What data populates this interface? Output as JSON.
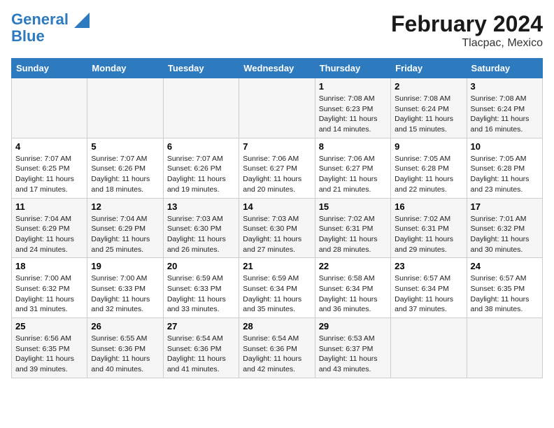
{
  "logo": {
    "line1": "General",
    "line2": "Blue"
  },
  "title": "February 2024",
  "subtitle": "Tlacpac, Mexico",
  "weekdays": [
    "Sunday",
    "Monday",
    "Tuesday",
    "Wednesday",
    "Thursday",
    "Friday",
    "Saturday"
  ],
  "weeks": [
    [
      {
        "day": "",
        "info": ""
      },
      {
        "day": "",
        "info": ""
      },
      {
        "day": "",
        "info": ""
      },
      {
        "day": "",
        "info": ""
      },
      {
        "day": "1",
        "info": "Sunrise: 7:08 AM\nSunset: 6:23 PM\nDaylight: 11 hours\nand 14 minutes."
      },
      {
        "day": "2",
        "info": "Sunrise: 7:08 AM\nSunset: 6:24 PM\nDaylight: 11 hours\nand 15 minutes."
      },
      {
        "day": "3",
        "info": "Sunrise: 7:08 AM\nSunset: 6:24 PM\nDaylight: 11 hours\nand 16 minutes."
      }
    ],
    [
      {
        "day": "4",
        "info": "Sunrise: 7:07 AM\nSunset: 6:25 PM\nDaylight: 11 hours\nand 17 minutes."
      },
      {
        "day": "5",
        "info": "Sunrise: 7:07 AM\nSunset: 6:26 PM\nDaylight: 11 hours\nand 18 minutes."
      },
      {
        "day": "6",
        "info": "Sunrise: 7:07 AM\nSunset: 6:26 PM\nDaylight: 11 hours\nand 19 minutes."
      },
      {
        "day": "7",
        "info": "Sunrise: 7:06 AM\nSunset: 6:27 PM\nDaylight: 11 hours\nand 20 minutes."
      },
      {
        "day": "8",
        "info": "Sunrise: 7:06 AM\nSunset: 6:27 PM\nDaylight: 11 hours\nand 21 minutes."
      },
      {
        "day": "9",
        "info": "Sunrise: 7:05 AM\nSunset: 6:28 PM\nDaylight: 11 hours\nand 22 minutes."
      },
      {
        "day": "10",
        "info": "Sunrise: 7:05 AM\nSunset: 6:28 PM\nDaylight: 11 hours\nand 23 minutes."
      }
    ],
    [
      {
        "day": "11",
        "info": "Sunrise: 7:04 AM\nSunset: 6:29 PM\nDaylight: 11 hours\nand 24 minutes."
      },
      {
        "day": "12",
        "info": "Sunrise: 7:04 AM\nSunset: 6:29 PM\nDaylight: 11 hours\nand 25 minutes."
      },
      {
        "day": "13",
        "info": "Sunrise: 7:03 AM\nSunset: 6:30 PM\nDaylight: 11 hours\nand 26 minutes."
      },
      {
        "day": "14",
        "info": "Sunrise: 7:03 AM\nSunset: 6:30 PM\nDaylight: 11 hours\nand 27 minutes."
      },
      {
        "day": "15",
        "info": "Sunrise: 7:02 AM\nSunset: 6:31 PM\nDaylight: 11 hours\nand 28 minutes."
      },
      {
        "day": "16",
        "info": "Sunrise: 7:02 AM\nSunset: 6:31 PM\nDaylight: 11 hours\nand 29 minutes."
      },
      {
        "day": "17",
        "info": "Sunrise: 7:01 AM\nSunset: 6:32 PM\nDaylight: 11 hours\nand 30 minutes."
      }
    ],
    [
      {
        "day": "18",
        "info": "Sunrise: 7:00 AM\nSunset: 6:32 PM\nDaylight: 11 hours\nand 31 minutes."
      },
      {
        "day": "19",
        "info": "Sunrise: 7:00 AM\nSunset: 6:33 PM\nDaylight: 11 hours\nand 32 minutes."
      },
      {
        "day": "20",
        "info": "Sunrise: 6:59 AM\nSunset: 6:33 PM\nDaylight: 11 hours\nand 33 minutes."
      },
      {
        "day": "21",
        "info": "Sunrise: 6:59 AM\nSunset: 6:34 PM\nDaylight: 11 hours\nand 35 minutes."
      },
      {
        "day": "22",
        "info": "Sunrise: 6:58 AM\nSunset: 6:34 PM\nDaylight: 11 hours\nand 36 minutes."
      },
      {
        "day": "23",
        "info": "Sunrise: 6:57 AM\nSunset: 6:34 PM\nDaylight: 11 hours\nand 37 minutes."
      },
      {
        "day": "24",
        "info": "Sunrise: 6:57 AM\nSunset: 6:35 PM\nDaylight: 11 hours\nand 38 minutes."
      }
    ],
    [
      {
        "day": "25",
        "info": "Sunrise: 6:56 AM\nSunset: 6:35 PM\nDaylight: 11 hours\nand 39 minutes."
      },
      {
        "day": "26",
        "info": "Sunrise: 6:55 AM\nSunset: 6:36 PM\nDaylight: 11 hours\nand 40 minutes."
      },
      {
        "day": "27",
        "info": "Sunrise: 6:54 AM\nSunset: 6:36 PM\nDaylight: 11 hours\nand 41 minutes."
      },
      {
        "day": "28",
        "info": "Sunrise: 6:54 AM\nSunset: 6:36 PM\nDaylight: 11 hours\nand 42 minutes."
      },
      {
        "day": "29",
        "info": "Sunrise: 6:53 AM\nSunset: 6:37 PM\nDaylight: 11 hours\nand 43 minutes."
      },
      {
        "day": "",
        "info": ""
      },
      {
        "day": "",
        "info": ""
      }
    ]
  ]
}
